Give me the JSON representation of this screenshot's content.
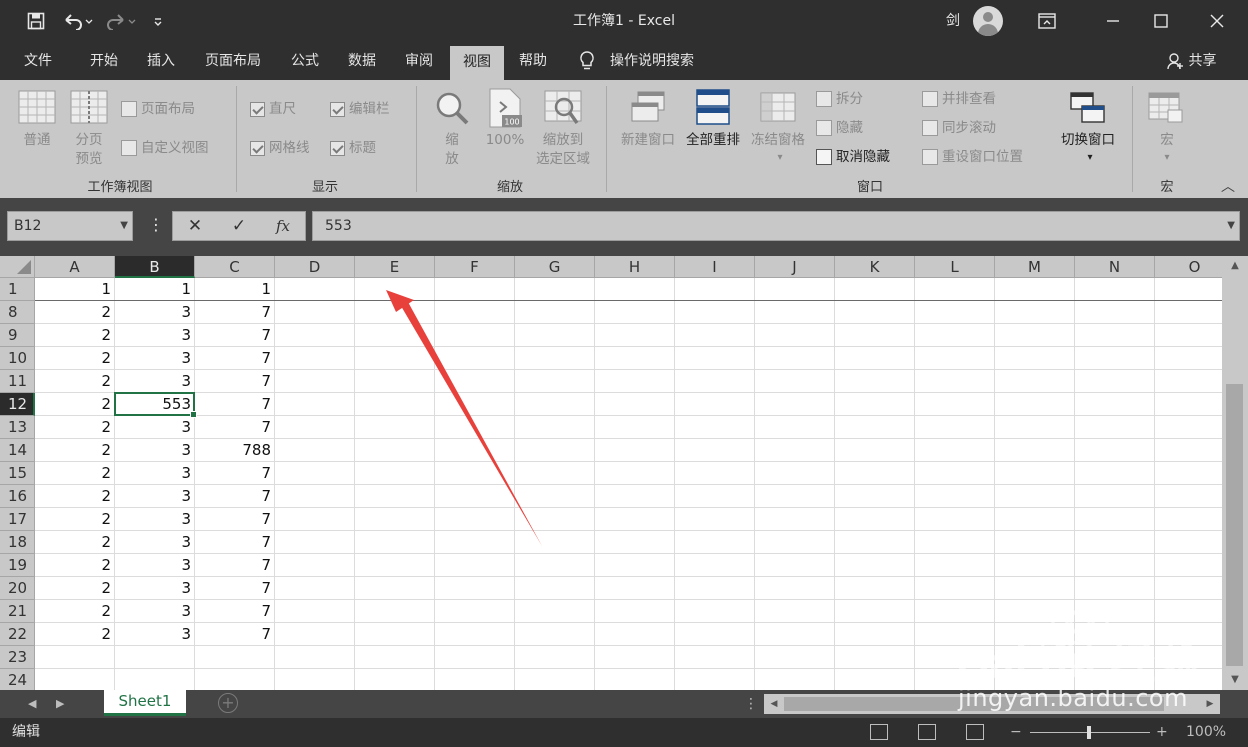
{
  "window": {
    "title": "工作簿1  -  Excel",
    "user": "剑"
  },
  "tabs": [
    {
      "label": "文件"
    },
    {
      "label": "开始"
    },
    {
      "label": "插入"
    },
    {
      "label": "页面布局"
    },
    {
      "label": "公式"
    },
    {
      "label": "数据"
    },
    {
      "label": "审阅"
    },
    {
      "label": "视图",
      "active": true
    },
    {
      "label": "帮助"
    }
  ],
  "tell_me": "操作说明搜索",
  "share": "共享",
  "ribbon": {
    "workbook_views": {
      "group": "工作簿视图",
      "normal": "普通",
      "page_break_1": "分页",
      "page_break_2": "预览",
      "page_layout": "页面布局",
      "custom_views": "自定义视图"
    },
    "show": {
      "group": "显示",
      "ruler": "直尺",
      "formula_bar": "编辑栏",
      "gridlines": "网格线",
      "headings": "标题"
    },
    "zoom": {
      "group": "缩放",
      "zoom_1": "缩",
      "zoom_2": "放",
      "hundred": "100%",
      "to_selection_1": "缩放到",
      "to_selection_2": "选定区域",
      "icon_badge": "100"
    },
    "window": {
      "group": "窗口",
      "new_window": "新建窗口",
      "arrange_all": "全部重排",
      "freeze_panes": "冻结窗格",
      "split": "拆分",
      "hide": "隐藏",
      "unhide": "取消隐藏",
      "side_by_side": "并排查看",
      "sync_scroll": "同步滚动",
      "reset_position": "重设窗口位置",
      "switch_windows": "切换窗口"
    },
    "macros": {
      "group": "宏",
      "macros": "宏"
    }
  },
  "formula_bar": {
    "name_box": "B12",
    "value": "553",
    "fx": "fx"
  },
  "grid": {
    "columns": [
      "A",
      "B",
      "C",
      "D",
      "E",
      "F",
      "G",
      "H",
      "I",
      "J",
      "K",
      "L",
      "M",
      "N",
      "O"
    ],
    "selected_column": "B",
    "selected_row": "12",
    "rows": [
      {
        "num": "1",
        "a": "1",
        "b": "1",
        "c": "1"
      },
      {
        "num": "8",
        "a": "2",
        "b": "3",
        "c": "7"
      },
      {
        "num": "9",
        "a": "2",
        "b": "3",
        "c": "7"
      },
      {
        "num": "10",
        "a": "2",
        "b": "3",
        "c": "7"
      },
      {
        "num": "11",
        "a": "2",
        "b": "3",
        "c": "7"
      },
      {
        "num": "12",
        "a": "2",
        "b": "553",
        "c": "7"
      },
      {
        "num": "13",
        "a": "2",
        "b": "3",
        "c": "7"
      },
      {
        "num": "14",
        "a": "2",
        "b": "3",
        "c": "788"
      },
      {
        "num": "15",
        "a": "2",
        "b": "3",
        "c": "7"
      },
      {
        "num": "16",
        "a": "2",
        "b": "3",
        "c": "7"
      },
      {
        "num": "17",
        "a": "2",
        "b": "3",
        "c": "7"
      },
      {
        "num": "18",
        "a": "2",
        "b": "3",
        "c": "7"
      },
      {
        "num": "19",
        "a": "2",
        "b": "3",
        "c": "7"
      },
      {
        "num": "20",
        "a": "2",
        "b": "3",
        "c": "7"
      },
      {
        "num": "21",
        "a": "2",
        "b": "3",
        "c": "7"
      },
      {
        "num": "22",
        "a": "2",
        "b": "3",
        "c": "7"
      },
      {
        "num": "23",
        "a": "",
        "b": "",
        "c": ""
      },
      {
        "num": "24",
        "a": "",
        "b": "",
        "c": ""
      }
    ]
  },
  "sheets": [
    {
      "label": "Sheet1",
      "active": true
    }
  ],
  "status": {
    "mode": "编辑",
    "zoom": "100%"
  },
  "watermark": {
    "brand": "Bai du 经验",
    "url": "jingyan.baidu.com"
  },
  "colors": {
    "accent": "#217346",
    "annotation": "#e8413c"
  }
}
